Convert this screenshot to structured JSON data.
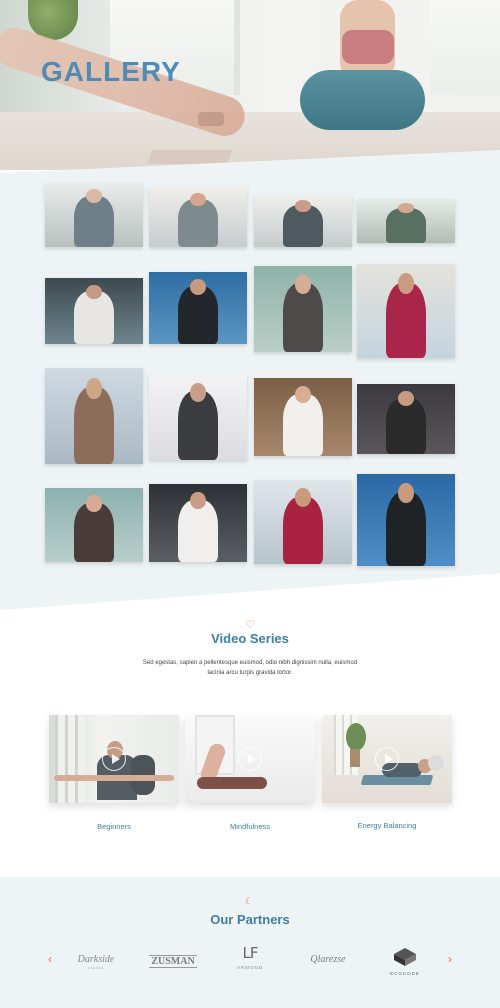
{
  "hero": {
    "title": "GALLERY"
  },
  "video_section": {
    "icon": "heart-icon",
    "title": "Video Series",
    "description": "Sed egestas, sapien a pellentesque euismod, odio nibh dignissim nulla, euismod lacinia arcu turpis gravida tortor.",
    "cards": [
      {
        "label": "Beginners"
      },
      {
        "label": "Mindfulness"
      },
      {
        "label": "Energy Balancing"
      }
    ]
  },
  "partners": {
    "icon": "moon-icon",
    "title": "Our Partners",
    "logos": [
      {
        "name": "Darkside",
        "sub": "studio"
      },
      {
        "name": "ZUSMAN",
        "sub": ""
      },
      {
        "name": "ARMOND",
        "mark": "LF"
      },
      {
        "name": "Qlarezse",
        "sub": ""
      },
      {
        "name": "ECOCODE",
        "mark": "cube"
      }
    ]
  },
  "colors": {
    "accent_blue": "#3e7fa8",
    "accent_coral": "#e06a52",
    "section_bg": "#eef4f5"
  }
}
